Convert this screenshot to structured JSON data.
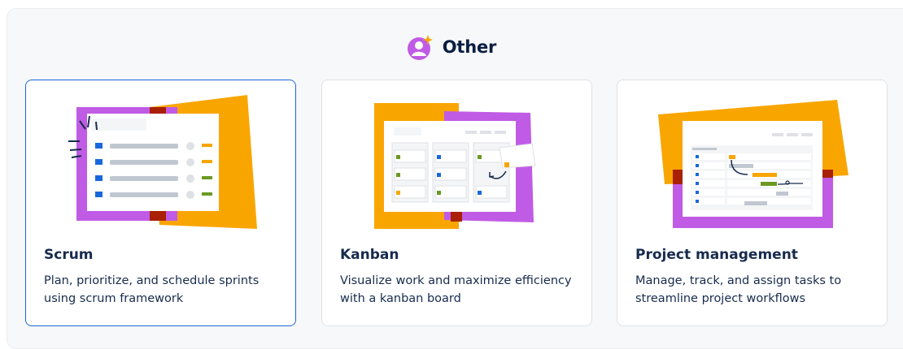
{
  "section": {
    "title": "Other",
    "icon": "person-sparkle-icon"
  },
  "colors": {
    "purple": "#c05be5",
    "orange": "#f9a500",
    "dark_red": "#a92004",
    "blue": "#1868db",
    "green": "#6a9a23",
    "selected_border": "#1868db"
  },
  "templates": [
    {
      "title": "Scrum",
      "description_line1": "Plan, prioritize, and schedule sprints",
      "description_line2": "using scrum framework",
      "selected": true,
      "illustration": "scrum-board-illustration"
    },
    {
      "title": "Kanban",
      "description_line1": "Visualize work and maximize efficiency",
      "description_line2": "with a kanban board",
      "selected": false,
      "illustration": "kanban-board-illustration"
    },
    {
      "title": "Project management",
      "description_line1": "Manage, track, and assign tasks to",
      "description_line2": "streamline project workflows",
      "selected": false,
      "illustration": "timeline-illustration"
    }
  ]
}
